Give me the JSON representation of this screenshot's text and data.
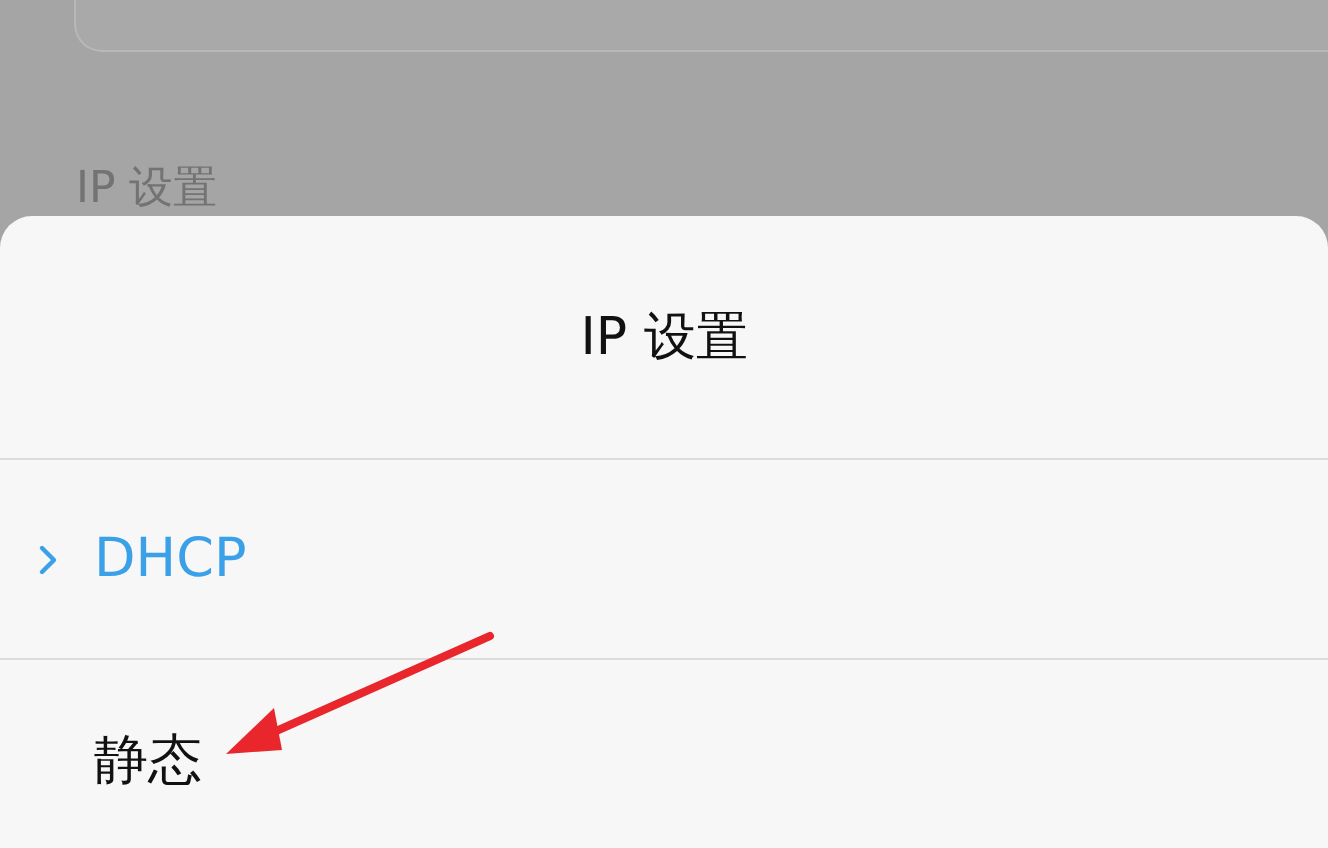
{
  "background": {
    "section_label": "IP 设置"
  },
  "sheet": {
    "title": "IP 设置",
    "options": [
      {
        "label": "DHCP",
        "selected": true
      },
      {
        "label": "静态",
        "selected": false
      }
    ]
  }
}
